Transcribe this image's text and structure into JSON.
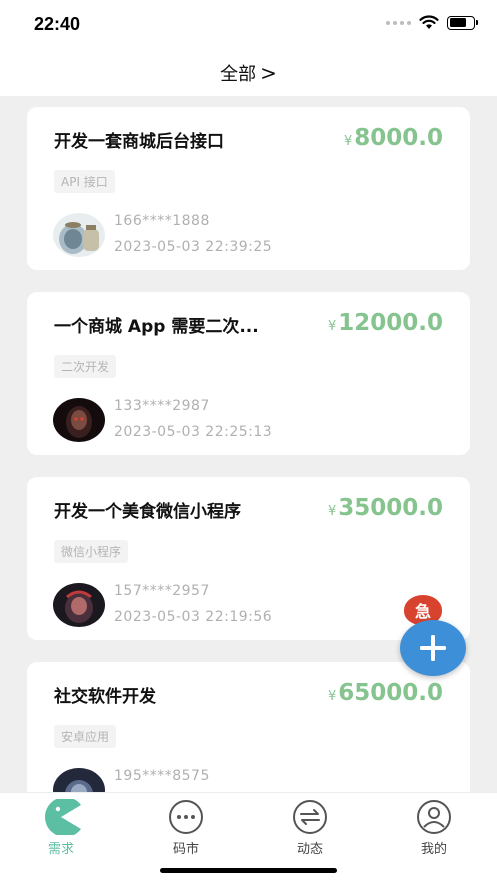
{
  "status_bar": {
    "time": "22:40"
  },
  "nav": {
    "title": "全部",
    "chevron": ">"
  },
  "currency_symbol": "¥",
  "cards": [
    {
      "title": "开发一套商城后台接口",
      "price": "8000.0",
      "tag": "API 接口",
      "phone": "166****1888",
      "time": "2023-05-03 22:39:25"
    },
    {
      "title": "一个商城 App 需要二次...",
      "price": "12000.0",
      "tag": "二次开发",
      "phone": "133****2987",
      "time": "2023-05-03 22:25:13"
    },
    {
      "title": "开发一个美食微信小程序",
      "price": "35000.0",
      "tag": "微信小程序",
      "phone": "157****2957",
      "time": "2023-05-03 22:19:56"
    },
    {
      "title": "社交软件开发",
      "price": "65000.0",
      "tag": "安卓应用",
      "phone": "195****8575",
      "time": ""
    }
  ],
  "urgent_badge": "急",
  "tabs": [
    {
      "label": "需求",
      "icon": "pacman-icon",
      "active": true
    },
    {
      "label": "码市",
      "icon": "chat-bubble-icon",
      "active": false
    },
    {
      "label": "动态",
      "icon": "swap-arrows-icon",
      "active": false
    },
    {
      "label": "我的",
      "icon": "user-icon",
      "active": false
    }
  ],
  "colors": {
    "accent": "#5cbfa3",
    "price": "#86c48f",
    "fab": "#3d8fd8",
    "urgent": "#d7432f"
  }
}
